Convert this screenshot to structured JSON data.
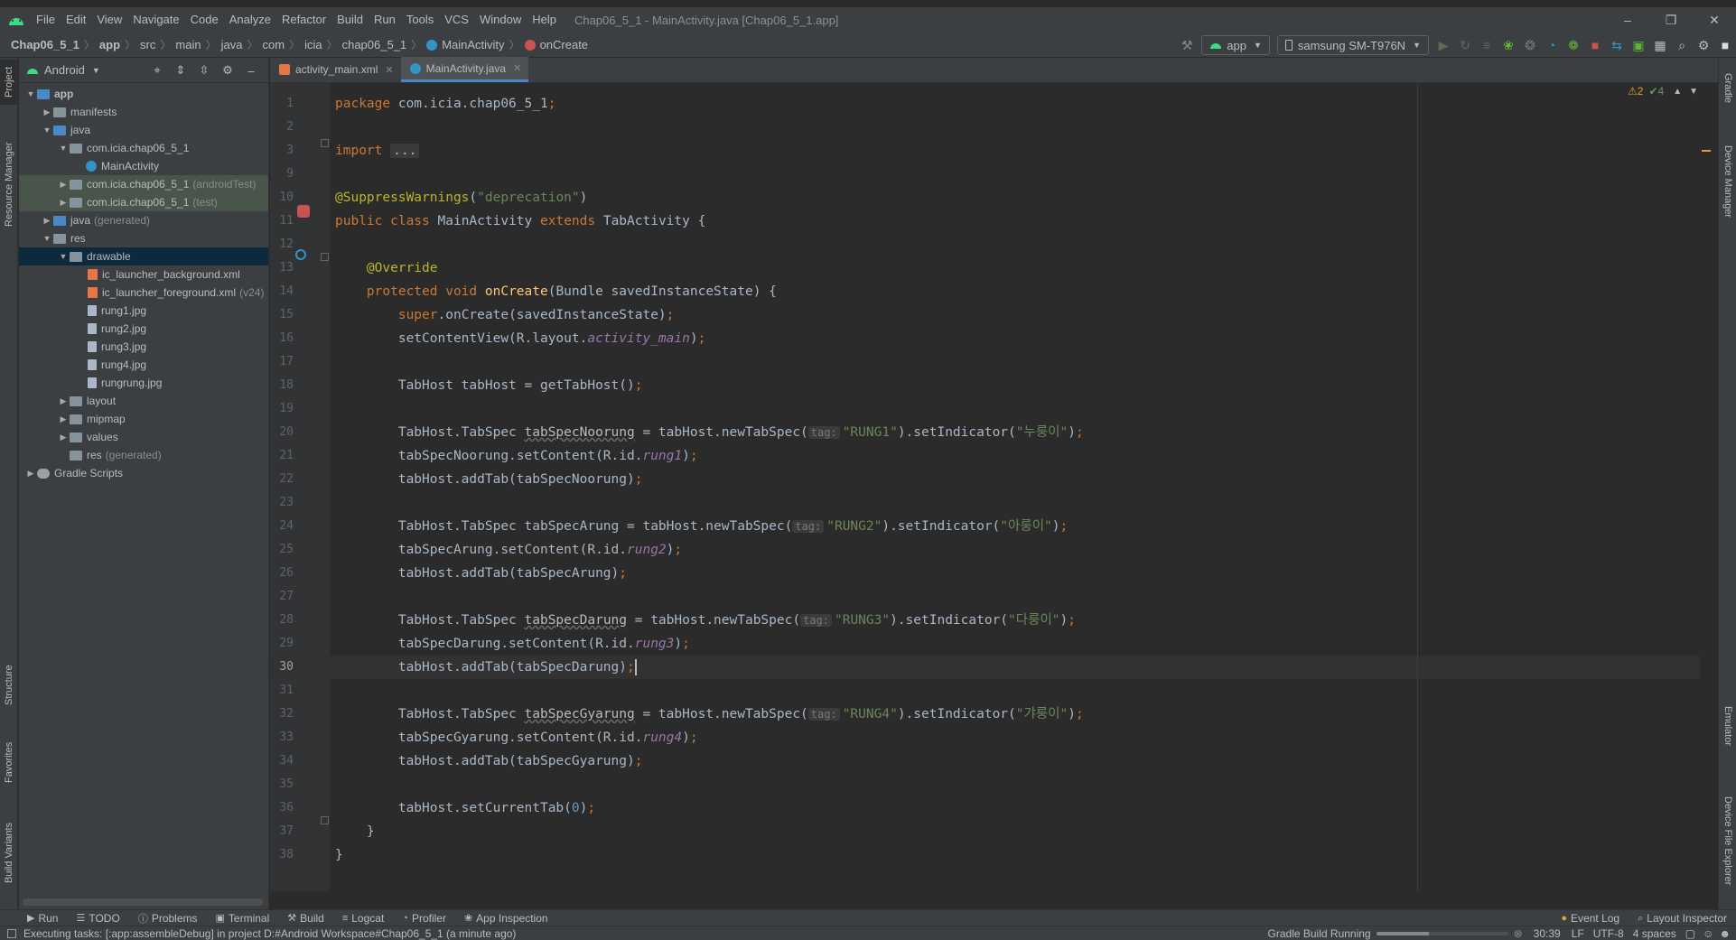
{
  "menu": {
    "items": [
      "File",
      "Edit",
      "View",
      "Navigate",
      "Code",
      "Analyze",
      "Refactor",
      "Build",
      "Run",
      "Tools",
      "VCS",
      "Window",
      "Help"
    ],
    "title": "Chap06_5_1 - MainActivity.java [Chap06_5_1.app]"
  },
  "breadcrumbs": [
    "Chap06_5_1",
    "app",
    "src",
    "main",
    "java",
    "com",
    "icia",
    "chap06_5_1",
    "MainActivity",
    "onCreate"
  ],
  "toolbar": {
    "run_config": "app",
    "device": "samsung SM-T976N"
  },
  "left_stripe": [
    "Project",
    "Resource Manager",
    "Structure",
    "Favorites",
    "Build Variants"
  ],
  "right_stripe": [
    "Gradle",
    "Device Manager",
    "Emulator",
    "Device File Explorer"
  ],
  "project": {
    "view_mode": "Android",
    "tree": [
      {
        "label": "app",
        "depth": 0,
        "arrow": "open",
        "icon": "folder-blue",
        "note": ""
      },
      {
        "label": "manifests",
        "depth": 1,
        "arrow": "closed",
        "icon": "folder",
        "note": ""
      },
      {
        "label": "java",
        "depth": 1,
        "arrow": "open",
        "icon": "folder-blue",
        "note": ""
      },
      {
        "label": "com.icia.chap06_5_1",
        "depth": 2,
        "arrow": "open",
        "icon": "folder",
        "note": ""
      },
      {
        "label": "MainActivity",
        "depth": 3,
        "arrow": "none",
        "icon": "class",
        "note": ""
      },
      {
        "label": "com.icia.chap06_5_1",
        "depth": 2,
        "arrow": "closed",
        "icon": "folder",
        "note": "(androidTest)"
      },
      {
        "label": "com.icia.chap06_5_1",
        "depth": 2,
        "arrow": "closed",
        "icon": "folder",
        "note": "(test)"
      },
      {
        "label": "java",
        "depth": 1,
        "arrow": "closed",
        "icon": "folder-blue",
        "note": "(generated)"
      },
      {
        "label": "res",
        "depth": 1,
        "arrow": "open",
        "icon": "folder",
        "note": ""
      },
      {
        "label": "drawable",
        "depth": 2,
        "arrow": "open",
        "icon": "folder",
        "note": ""
      },
      {
        "label": "ic_launcher_background.xml",
        "depth": 3,
        "arrow": "none",
        "icon": "xml",
        "note": ""
      },
      {
        "label": "ic_launcher_foreground.xml",
        "depth": 3,
        "arrow": "none",
        "icon": "xml",
        "note": "(v24)"
      },
      {
        "label": "rung1.jpg",
        "depth": 3,
        "arrow": "none",
        "icon": "file",
        "note": ""
      },
      {
        "label": "rung2.jpg",
        "depth": 3,
        "arrow": "none",
        "icon": "file",
        "note": ""
      },
      {
        "label": "rung3.jpg",
        "depth": 3,
        "arrow": "none",
        "icon": "file",
        "note": ""
      },
      {
        "label": "rung4.jpg",
        "depth": 3,
        "arrow": "none",
        "icon": "file",
        "note": ""
      },
      {
        "label": "rungrung.jpg",
        "depth": 3,
        "arrow": "none",
        "icon": "file",
        "note": ""
      },
      {
        "label": "layout",
        "depth": 2,
        "arrow": "closed",
        "icon": "folder",
        "note": ""
      },
      {
        "label": "mipmap",
        "depth": 2,
        "arrow": "closed",
        "icon": "folder",
        "note": ""
      },
      {
        "label": "values",
        "depth": 2,
        "arrow": "closed",
        "icon": "folder",
        "note": ""
      },
      {
        "label": "res",
        "depth": 2,
        "arrow": "none",
        "icon": "folder",
        "note": "(generated)"
      },
      {
        "label": "Gradle Scripts",
        "depth": 0,
        "arrow": "closed",
        "icon": "gradle",
        "note": ""
      }
    ]
  },
  "editor": {
    "tabs": [
      {
        "label": "activity_main.xml",
        "active": false
      },
      {
        "label": "MainActivity.java",
        "active": true
      }
    ],
    "warnings": "2",
    "weak_warnings": "4",
    "current_line": 30,
    "lines": [
      {
        "n": "1",
        "code": [
          [
            "kw",
            "package "
          ],
          [
            "def",
            "com.icia.chap06_5_1"
          ],
          [
            "kw",
            ";"
          ]
        ]
      },
      {
        "n": "2",
        "code": []
      },
      {
        "n": "3",
        "code": [
          [
            "kw",
            "import "
          ],
          [
            "fold",
            "..."
          ]
        ]
      },
      {
        "n": "9",
        "code": []
      },
      {
        "n": "10",
        "code": [
          [
            "ann",
            "@SuppressWarnings"
          ],
          [
            "def",
            "("
          ],
          [
            "str",
            "\"deprecation\""
          ],
          [
            "def",
            ")"
          ]
        ]
      },
      {
        "n": "11",
        "code": [
          [
            "kw",
            "public class "
          ],
          [
            "def",
            "MainActivity "
          ],
          [
            "kw",
            "extends "
          ],
          [
            "def",
            "TabActivity {"
          ]
        ]
      },
      {
        "n": "12",
        "code": []
      },
      {
        "n": "13",
        "code": [
          [
            "def",
            "    "
          ],
          [
            "ann",
            "@Override"
          ]
        ]
      },
      {
        "n": "14",
        "code": [
          [
            "def",
            "    "
          ],
          [
            "kw",
            "protected void "
          ],
          [
            "fn",
            "onCreate"
          ],
          [
            "def",
            "(Bundle savedInstanceState) {"
          ]
        ]
      },
      {
        "n": "15",
        "code": [
          [
            "def",
            "        "
          ],
          [
            "kw",
            "super"
          ],
          [
            "def",
            ".onCreate(savedInstanceState)"
          ],
          [
            "kw",
            ";"
          ]
        ]
      },
      {
        "n": "16",
        "code": [
          [
            "def",
            "        setContentView(R.layout."
          ],
          [
            "fld",
            "activity_main"
          ],
          [
            "def",
            ")"
          ],
          [
            "kw",
            ";"
          ]
        ]
      },
      {
        "n": "17",
        "code": []
      },
      {
        "n": "18",
        "code": [
          [
            "def",
            "        TabHost tabHost = getTabHost()"
          ],
          [
            "kw",
            ";"
          ]
        ]
      },
      {
        "n": "19",
        "code": []
      },
      {
        "n": "20",
        "code": [
          [
            "def",
            "        TabHost.TabSpec "
          ],
          [
            "squig",
            "tabSpecNoorung"
          ],
          [
            "def",
            " = tabHost.newTabSpec("
          ],
          [
            "hint",
            "tag:"
          ],
          [
            "str",
            "\"RUNG1\""
          ],
          [
            "def",
            ").setIndicator("
          ],
          [
            "str",
            "\"누룽이\""
          ],
          [
            "def",
            ")"
          ],
          [
            "kw",
            ";"
          ]
        ]
      },
      {
        "n": "21",
        "code": [
          [
            "def",
            "        tabSpecNoorung.setContent(R.id."
          ],
          [
            "fld",
            "rung1"
          ],
          [
            "def",
            ")"
          ],
          [
            "kw",
            ";"
          ]
        ]
      },
      {
        "n": "22",
        "code": [
          [
            "def",
            "        tabHost.addTab(tabSpecNoorung)"
          ],
          [
            "kw",
            ";"
          ]
        ]
      },
      {
        "n": "23",
        "code": []
      },
      {
        "n": "24",
        "code": [
          [
            "def",
            "        TabHost.TabSpec tabSpecArung = tabHost.newTabSpec("
          ],
          [
            "hint",
            "tag:"
          ],
          [
            "str",
            "\"RUNG2\""
          ],
          [
            "def",
            ").setIndicator("
          ],
          [
            "str",
            "\"아룽이\""
          ],
          [
            "def",
            ")"
          ],
          [
            "kw",
            ";"
          ]
        ]
      },
      {
        "n": "25",
        "code": [
          [
            "def",
            "        tabSpecArung.setContent(R.id."
          ],
          [
            "fld",
            "rung2"
          ],
          [
            "def",
            ")"
          ],
          [
            "kw",
            ";"
          ]
        ]
      },
      {
        "n": "26",
        "code": [
          [
            "def",
            "        tabHost.addTab(tabSpecArung)"
          ],
          [
            "kw",
            ";"
          ]
        ]
      },
      {
        "n": "27",
        "code": []
      },
      {
        "n": "28",
        "code": [
          [
            "def",
            "        TabHost.TabSpec "
          ],
          [
            "squig",
            "tabSpecDarung"
          ],
          [
            "def",
            " = tabHost.newTabSpec("
          ],
          [
            "hint",
            "tag:"
          ],
          [
            "str",
            "\"RUNG3\""
          ],
          [
            "def",
            ").setIndicator("
          ],
          [
            "str",
            "\"다룽이\""
          ],
          [
            "def",
            ")"
          ],
          [
            "kw",
            ";"
          ]
        ]
      },
      {
        "n": "29",
        "code": [
          [
            "def",
            "        tabSpecDarung.setContent(R.id."
          ],
          [
            "fld",
            "rung3"
          ],
          [
            "def",
            ")"
          ],
          [
            "kw",
            ";"
          ]
        ]
      },
      {
        "n": "30",
        "code": [
          [
            "def",
            "        tabHost.addTab(tabSpecDarung)"
          ],
          [
            "kw",
            ";"
          ],
          [
            "caret",
            ""
          ]
        ]
      },
      {
        "n": "31",
        "code": []
      },
      {
        "n": "32",
        "code": [
          [
            "def",
            "        TabHost.TabSpec "
          ],
          [
            "squig",
            "tabSpecGyarung"
          ],
          [
            "def",
            " = tabHost.newTabSpec("
          ],
          [
            "hint",
            "tag:"
          ],
          [
            "str",
            "\"RUNG4\""
          ],
          [
            "def",
            ").setIndicator("
          ],
          [
            "str",
            "\"갸룽이\""
          ],
          [
            "def",
            ")"
          ],
          [
            "kw",
            ";"
          ]
        ]
      },
      {
        "n": "33",
        "code": [
          [
            "def",
            "        tabSpecGyarung.setContent(R.id."
          ],
          [
            "fld",
            "rung4"
          ],
          [
            "def",
            ")"
          ],
          [
            "kw",
            ";"
          ]
        ]
      },
      {
        "n": "34",
        "code": [
          [
            "def",
            "        tabHost.addTab(tabSpecGyarung)"
          ],
          [
            "kw",
            ";"
          ]
        ]
      },
      {
        "n": "35",
        "code": []
      },
      {
        "n": "36",
        "code": [
          [
            "def",
            "        tabHost.setCurrentTab("
          ],
          [
            "num",
            "0"
          ],
          [
            "def",
            ")"
          ],
          [
            "kw",
            ";"
          ]
        ]
      },
      {
        "n": "37",
        "code": [
          [
            "def",
            "    }"
          ]
        ]
      },
      {
        "n": "38",
        "code": [
          [
            "def",
            "}"
          ]
        ]
      }
    ]
  },
  "bottom_tools": [
    "Run",
    "TODO",
    "Problems",
    "Terminal",
    "Build",
    "Logcat",
    "Profiler",
    "App Inspection"
  ],
  "bottom_right_tools": [
    "Event Log",
    "Layout Inspector"
  ],
  "status": {
    "message": "Executing tasks: [:app:assembleDebug] in project D:#Android Workspace#Chap06_5_1 (a minute ago)",
    "task": "Gradle Build Running",
    "position": "30:39",
    "line_sep": "LF",
    "encoding": "UTF-8",
    "indent": "4 spaces"
  },
  "colors": {
    "accent": "#4a88c7",
    "keyword": "#cc7832",
    "annotation": "#bbb529",
    "string": "#6a8759",
    "field": "#9876aa",
    "function": "#ffc66d"
  }
}
